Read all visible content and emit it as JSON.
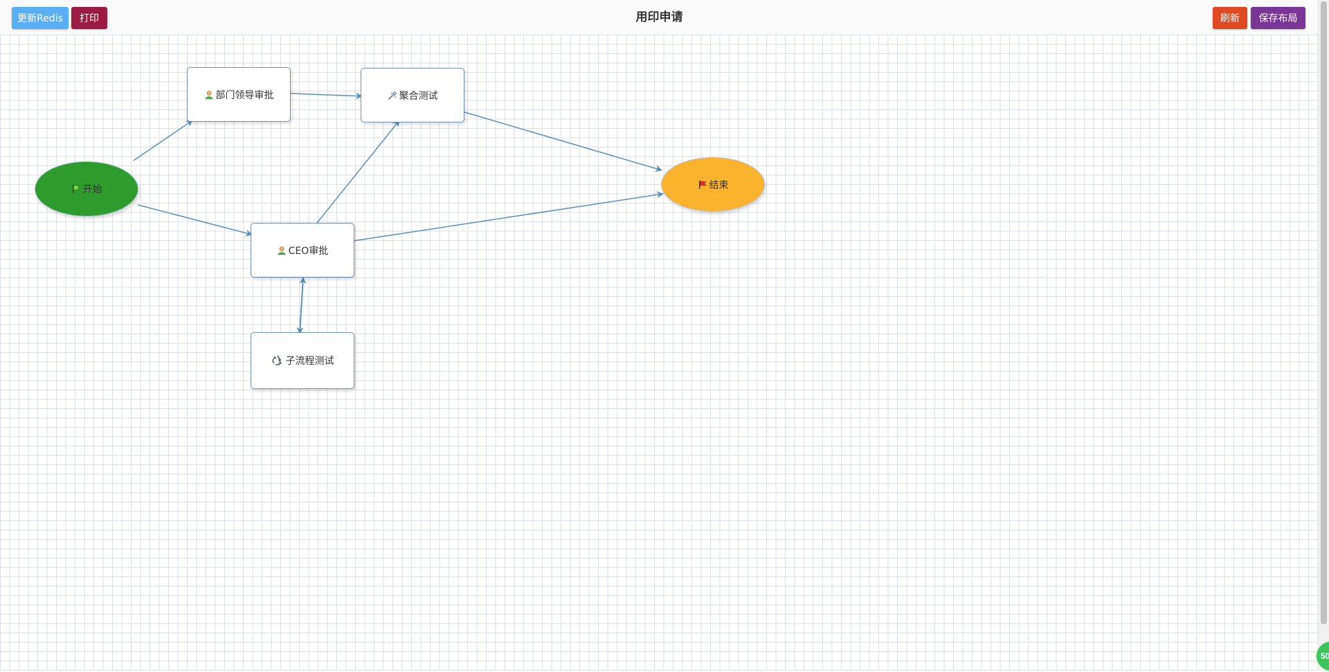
{
  "header": {
    "title": "用印申请",
    "buttons": {
      "update_redis": "更新Redis",
      "print": "打印",
      "refresh": "刷新",
      "save_layout": "保存布局"
    }
  },
  "colors": {
    "update_redis": "#5aaef2",
    "print": "#9b1b45",
    "refresh": "#e04a22",
    "save_layout": "#7b3594",
    "edge": "#5b8fb9",
    "start_node": "#2e9b2e",
    "end_node": "#fbb22c"
  },
  "diagram": {
    "nodes": {
      "start": {
        "label": "开始",
        "icon": "flag-green-icon"
      },
      "dept_leader": {
        "label": "部门领导审批",
        "icon": "user-icon"
      },
      "aggregate_test": {
        "label": "聚合测试",
        "icon": "tools-icon"
      },
      "end": {
        "label": "结束",
        "icon": "flag-red-icon"
      },
      "ceo": {
        "label": "CEO审批",
        "icon": "user-icon"
      },
      "subprocess_test": {
        "label": "子流程测试",
        "icon": "recycle-icon"
      }
    },
    "edges": [
      {
        "from": "start",
        "to": "dept_leader"
      },
      {
        "from": "start",
        "to": "ceo"
      },
      {
        "from": "dept_leader",
        "to": "aggregate_test"
      },
      {
        "from": "ceo",
        "to": "aggregate_test"
      },
      {
        "from": "aggregate_test",
        "to": "end"
      },
      {
        "from": "ceo",
        "to": "end"
      },
      {
        "from": "ceo",
        "to": "subprocess_test"
      },
      {
        "from": "subprocess_test",
        "to": "ceo"
      }
    ]
  },
  "zoom_badge": "50"
}
